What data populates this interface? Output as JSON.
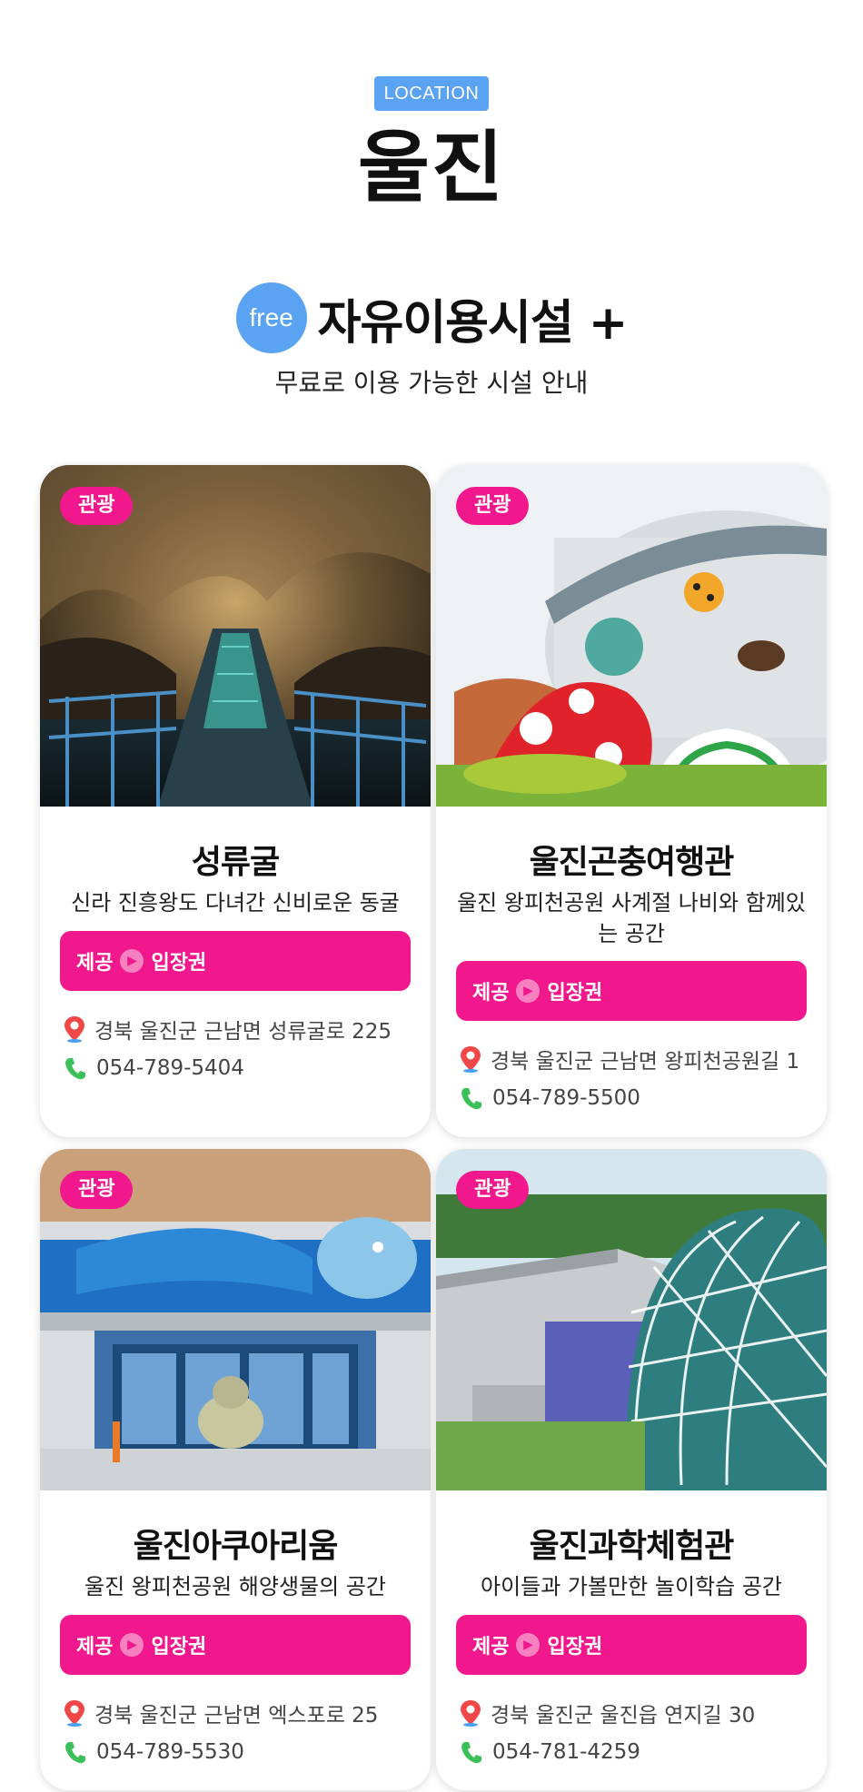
{
  "header": {
    "location_badge": "LOCATION",
    "city": "울진",
    "free_badge": "free",
    "free_title": "자유이용시설 +",
    "subtitle": "무료로 이용 가능한 시설 안내"
  },
  "colors": {
    "accent_blue": "#5aa2f2",
    "accent_pink": "#f0188c"
  },
  "cards": [
    {
      "tag": "관광",
      "photo": "limestone-cave-photo",
      "title": "성류굴",
      "desc": "신라 진흥왕도 다녀간 신비로운 동굴",
      "ticket_label": "제공",
      "ticket_value": "입장권",
      "address": "경북 울진군 근남면 성류굴로 225",
      "phone": "054-789-5404"
    },
    {
      "tag": "관광",
      "photo": "insect-museum-photo",
      "title": "울진곤충여행관",
      "desc": "울진 왕피천공원 사계절 나비와 함께있는 공간",
      "ticket_label": "제공",
      "ticket_value": "입장권",
      "address": "경북 울진군 근남면 왕피천공원길 1",
      "phone": "054-789-5500"
    },
    {
      "tag": "관광",
      "photo": "aquarium-photo",
      "title": "울진아쿠아리움",
      "desc": "울진 왕피천공원 해양생물의 공간",
      "ticket_label": "제공",
      "ticket_value": "입장권",
      "address": "경북 울진군 근남면 엑스포로 25",
      "phone": "054-789-5530"
    },
    {
      "tag": "관광",
      "photo": "science-center-photo",
      "title": "울진과학체험관",
      "desc": "아이들과 가볼만한 놀이학습 공간",
      "ticket_label": "제공",
      "ticket_value": "입장권",
      "address": "경북 울진군 울진읍 연지길 30",
      "phone": "054-781-4259"
    }
  ]
}
